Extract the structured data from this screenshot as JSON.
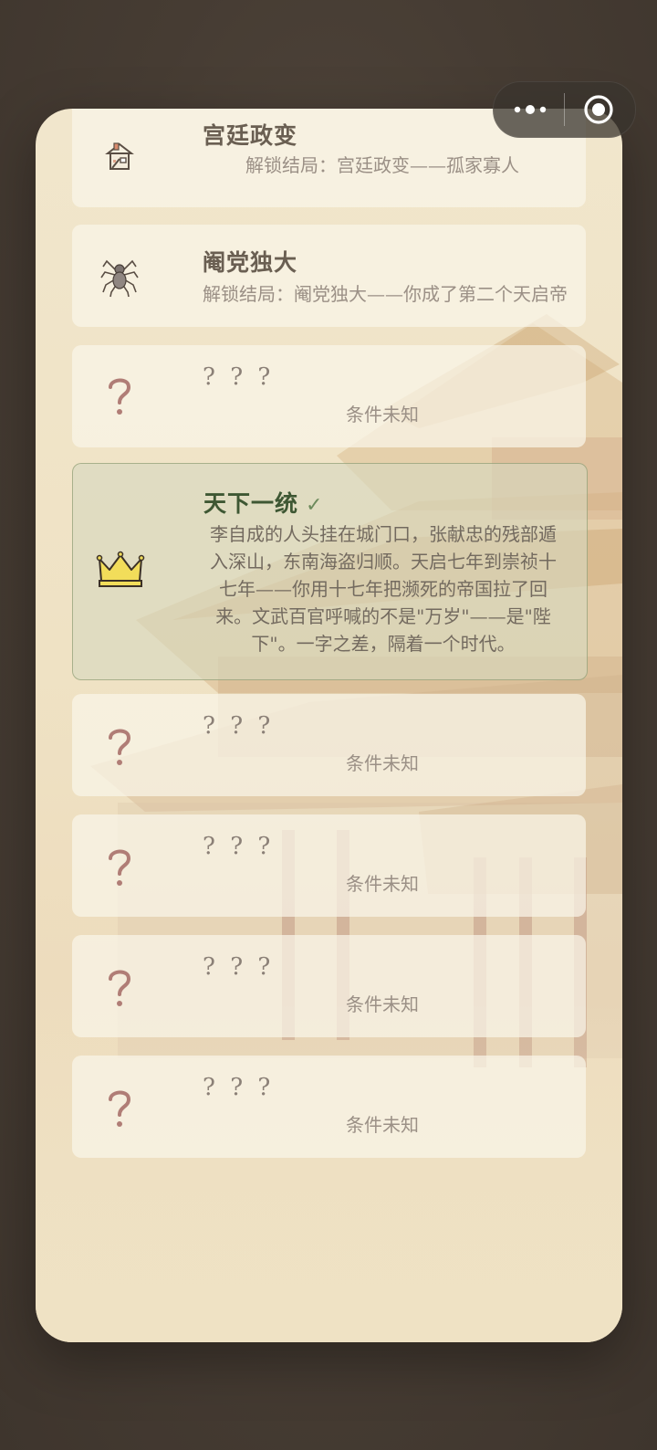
{
  "capsule": {
    "more_icon": "more-dots-icon",
    "close_icon": "target-circle-icon"
  },
  "endings": [
    {
      "icon": "house-icon",
      "title": "宫廷政变",
      "desc": "解锁结局：宫廷政变——孤家寡人",
      "unlocked": true
    },
    {
      "icon": "spider-icon",
      "title": "阉党独大",
      "desc": "解锁结局：阉党独大——你成了第二个天启帝",
      "unlocked": true
    },
    {
      "icon": "question-icon",
      "title": "? ? ?",
      "desc": "条件未知",
      "unlocked": false
    },
    {
      "icon": "crown-icon",
      "title": "天下一统",
      "check": "✓",
      "body": "李自成的人头挂在城门口，张献忠的残部遁入深山，东南海盗归顺。天启七年到崇祯十七年——你用十七年把濒死的帝国拉了回来。文武百官呼喊的不是\"万岁\"——是\"陛下\"。一字之差，隔着一个时代。",
      "unlocked": true,
      "highlight": true
    },
    {
      "icon": "question-icon",
      "title": "? ? ?",
      "desc": "条件未知",
      "unlocked": false
    },
    {
      "icon": "question-icon",
      "title": "? ? ?",
      "desc": "条件未知",
      "unlocked": false
    },
    {
      "icon": "question-icon",
      "title": "? ? ?",
      "desc": "条件未知",
      "unlocked": false
    },
    {
      "icon": "question-icon",
      "title": "? ? ?",
      "desc": "条件未知",
      "unlocked": false
    }
  ],
  "colors": {
    "panel": "#efe2c4",
    "card": "#faf5e9",
    "highlight_border": "#788c5f",
    "question": "#b07d76",
    "title": "#6a5f52",
    "title_unlocked_highlight": "#3e5733"
  }
}
